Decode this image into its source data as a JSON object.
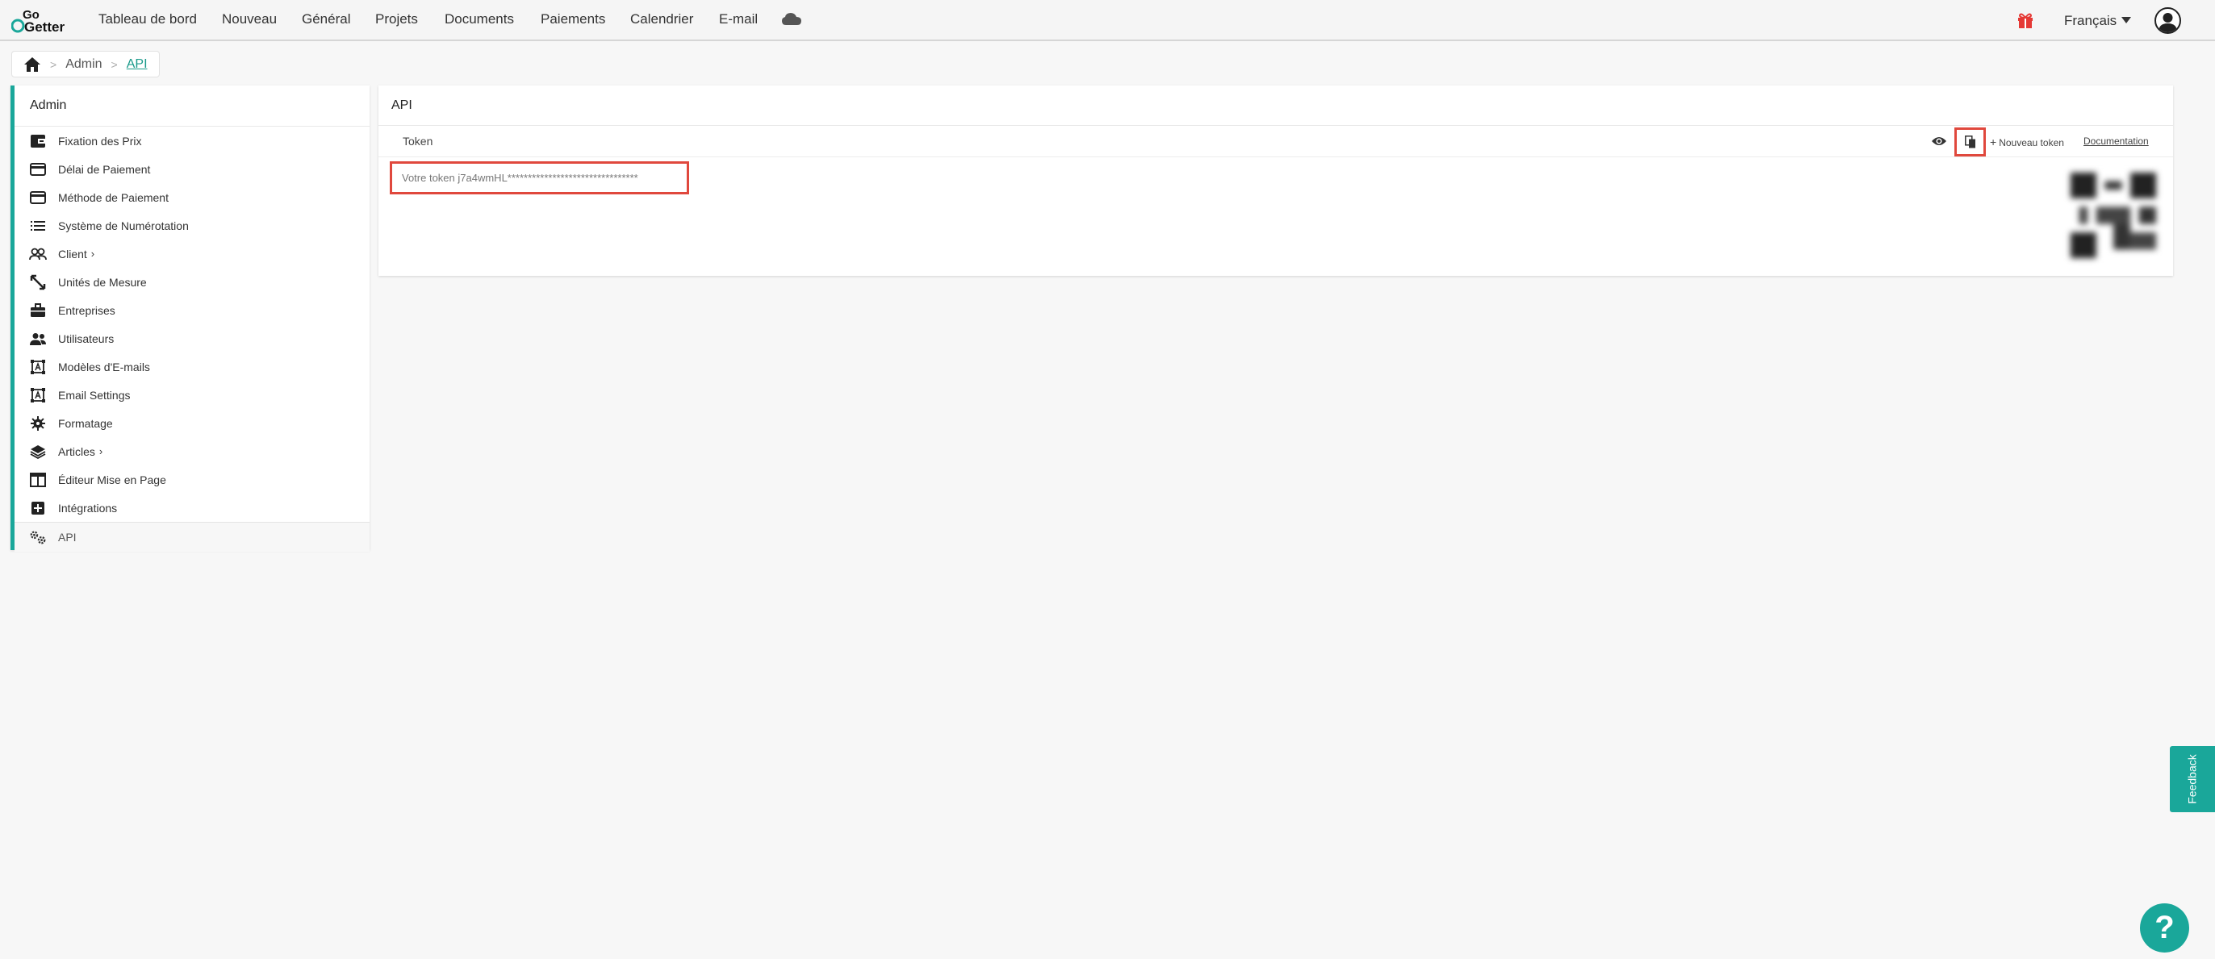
{
  "app": {
    "logo_text_top": "Go",
    "logo_text_bottom": "Getter"
  },
  "nav": {
    "items": [
      "Tableau de bord",
      "Nouveau",
      "Général",
      "Projets",
      "Documents",
      "Paiements",
      "Calendrier",
      "E-mail"
    ],
    "language": "Français"
  },
  "breadcrumb": {
    "items": [
      "Admin",
      "API"
    ]
  },
  "sidebar": {
    "title": "Admin",
    "items": [
      {
        "label": "Fixation des Prix",
        "icon": "wallet-icon"
      },
      {
        "label": "Délai de Paiement",
        "icon": "credit-card-icon"
      },
      {
        "label": "Méthode de Paiement",
        "icon": "credit-card-icon"
      },
      {
        "label": "Système de Numérotation",
        "icon": "list-icon"
      },
      {
        "label": "Client",
        "icon": "users-icon"
      },
      {
        "label": "Unités de Mesure",
        "icon": "ruler-icon"
      },
      {
        "label": "Entreprises",
        "icon": "briefcase-icon"
      },
      {
        "label": "Utilisateurs",
        "icon": "user-group-icon"
      },
      {
        "label": "Modèles d'E-mails",
        "icon": "template-icon"
      },
      {
        "label": "Email Settings",
        "icon": "template-icon"
      },
      {
        "label": "Formatage",
        "icon": "gear-icon"
      },
      {
        "label": "Articles",
        "icon": "layers-icon"
      },
      {
        "label": "Éditeur Mise en Page",
        "icon": "layout-icon"
      },
      {
        "label": "Intégrations",
        "icon": "plus-square-icon"
      },
      {
        "label": "API",
        "icon": "gears-icon"
      }
    ]
  },
  "main": {
    "title": "API",
    "token_label": "Token",
    "new_token_label": "Nouveau token",
    "documentation_label": "Documentation",
    "token_value": "Votre token j7a4wmHL********************************"
  },
  "feedback_label": "Feedback",
  "help_label": "?",
  "colors": {
    "accent": "#1aa79a",
    "highlight": "#e0483d",
    "gift": "#e53935"
  }
}
